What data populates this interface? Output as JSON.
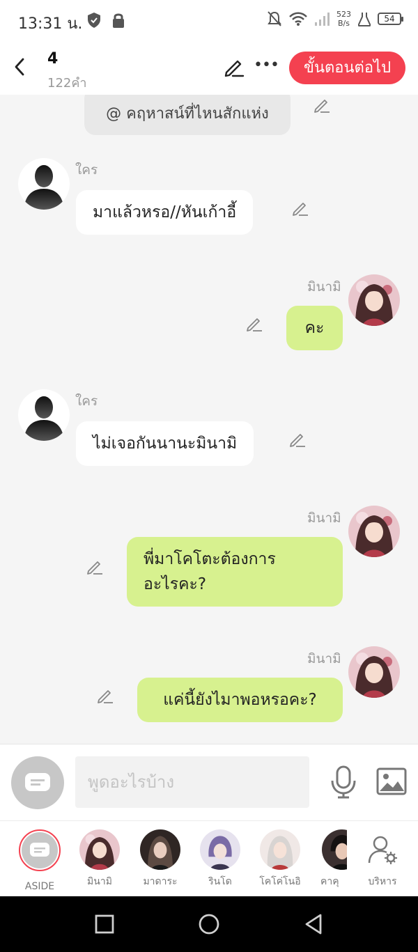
{
  "status_bar": {
    "time": "13:31 น.",
    "net_speed_value": "523",
    "net_speed_unit": "B/s",
    "battery": "54"
  },
  "header": {
    "title": "4",
    "word_count": "122คำ",
    "next_button": "ขั้นตอนต่อไป"
  },
  "chat": {
    "narration": "@ คฤหาสน์ที่ไหนสักแห่ง",
    "messages": [
      {
        "speaker": "ใคร",
        "side": "left",
        "text": "มาแล้วหรอ//หันเก้าอี้",
        "avatar": "silhouette"
      },
      {
        "speaker": "มินามิ",
        "side": "right",
        "text": "คะ",
        "avatar": "minami"
      },
      {
        "speaker": "ใคร",
        "side": "left",
        "text": "ไม่เจอกันนานะมินามิ",
        "avatar": "silhouette"
      },
      {
        "speaker": "มินามิ",
        "side": "right",
        "text_line1": "พี่มาโคโตะต้องการ",
        "text_line2": "อะไรคะ?",
        "avatar": "minami"
      },
      {
        "speaker": "มินามิ",
        "side": "right",
        "text": "แค่นี้ยังไมาพอหรอคะ?",
        "avatar": "minami"
      }
    ]
  },
  "composer": {
    "placeholder": "พูดอะไรบ้าง"
  },
  "characters": [
    {
      "label": "ASIDE",
      "selected": true
    },
    {
      "label": "มินามิ",
      "color": "#c8747f"
    },
    {
      "label": "มาดาระ",
      "color": "#3a2e2c"
    },
    {
      "label": "รินโด",
      "color": "#8c7fb4"
    },
    {
      "label": "โคโค่โนอิ",
      "color": "#d9c2bd"
    },
    {
      "label": "คาคุ",
      "color": "#2a2222"
    },
    {
      "label": "บริหาร"
    }
  ],
  "colors": {
    "accent": "#f44150",
    "bubble_right": "#d7f18f",
    "bubble_left": "#ffffff",
    "chat_background": "#f5f5f5"
  },
  "icons": [
    "back-arrow-icon",
    "pencil-icon",
    "more-icon",
    "mic-icon",
    "image-icon",
    "manage-icon",
    "aside-icon"
  ]
}
